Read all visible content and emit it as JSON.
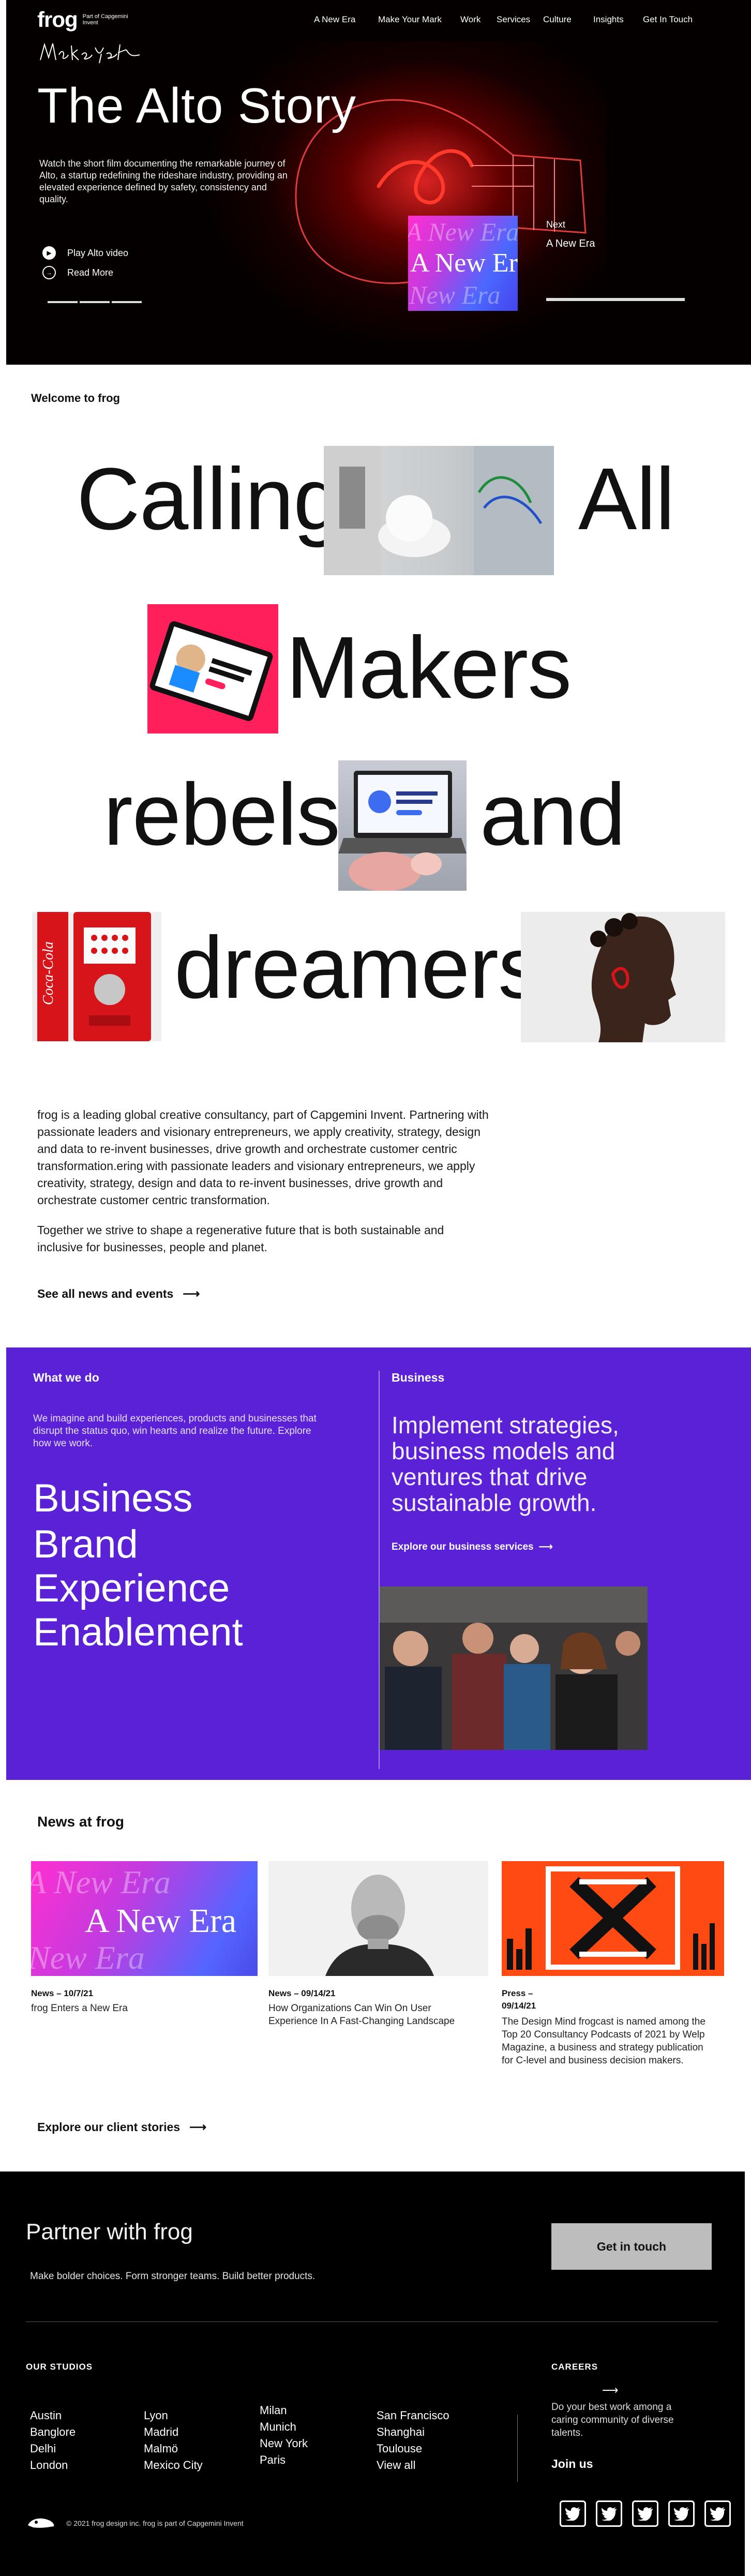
{
  "header": {
    "logo_word": "frog",
    "logo_sub": "Part of Capgemini Invent",
    "signature_text": "Make Your Mark",
    "nav": [
      "A New Era",
      "Make Your Mark",
      "Work",
      "Services",
      "Culture",
      "Insights",
      "Get In Touch"
    ]
  },
  "hero": {
    "title": "The Alto Story",
    "description": "Watch the short film documenting the remarkable journey of Alto, a startup redefining the rideshare industry, providing an elevated experience defined by safety, consistency and quality.",
    "play_label": "Play Alto video",
    "read_label": "Read More",
    "next_label": "Next",
    "next_title": "A New Era",
    "thumb_text": "A New Era"
  },
  "welcome": {
    "label": "Welcome to frog",
    "words": [
      "Calling",
      "All",
      "Makers",
      "rebels",
      "and",
      "dreamers"
    ]
  },
  "intro": {
    "paragraph1": "frog is a leading global creative consultancy, part of Capgemini Invent. Partnering with passionate leaders and visionary entrepreneurs, we apply creativity, strategy, design and data to re-invent businesses, drive growth and orchestrate customer centric transformation.ering with passionate leaders and visionary entrepreneurs, we apply creativity, strategy, design and data to re-invent businesses, drive growth and orchestrate customer centric transformation.",
    "paragraph2": "Together we strive to shape a regenerative future that is both sustainable and inclusive for businesses, people and planet.",
    "news_link": "See all news and events"
  },
  "what_we_do": {
    "label": "What we do",
    "text": "We imagine and build experiences, products and businesses that disrupt the status quo, win hearts and realize the future. Explore how we work.",
    "services": [
      "Business",
      "Brand",
      "Experience",
      "Enablement"
    ],
    "business_label": "Business",
    "business_heading": "Implement strategies, business models and ventures that drive sustainable growth.",
    "business_link": "Explore our business services"
  },
  "news": {
    "title": "News at frog",
    "items": [
      {
        "meta": "News – 10/7/21",
        "text": "frog Enters a New Era"
      },
      {
        "meta": "News – 09/14/21",
        "text": "How Organizations Can Win On User Experience In A Fast-Changing Landscape"
      },
      {
        "meta": "Press – 09/14/21",
        "text": "The Design Mind frogcast is named among the Top 20 Consultancy Podcasts of 2021 by Welp Magazine, a business and strategy publication for C-level and business decision makers."
      }
    ],
    "client_link": "Explore our client stories"
  },
  "footer": {
    "partner": "Partner with frog",
    "partner_sub": "Make bolder choices. Form stronger teams. Build better products.",
    "cta": "Get in touch",
    "studios_label": "OUR STUDIOS",
    "studios": [
      [
        "Austin",
        "Banglore",
        "Delhi",
        "London"
      ],
      [
        "Lyon",
        "Madrid",
        "Malmö",
        "Mexico City"
      ],
      [
        "Milan",
        "Munich",
        "New York",
        "Paris"
      ],
      [
        "San Francisco",
        "Shanghai",
        "Toulouse",
        "View all"
      ]
    ],
    "careers_label": "CAREERS",
    "careers_text": "Do your best work among a caring community of diverse talents.",
    "join": "Join us",
    "copyright": "© 2021 frog design inc. frog is part of Capgemini Invent"
  },
  "colors": {
    "purple": "#5b21d6",
    "hero_red": "#ff2b2b",
    "news_orange": "#ff4a14",
    "pink": "#ff1f5a"
  },
  "icons": [
    "play-icon",
    "arrow-right-icon",
    "frog-logo-icon",
    "twitter-icon"
  ]
}
